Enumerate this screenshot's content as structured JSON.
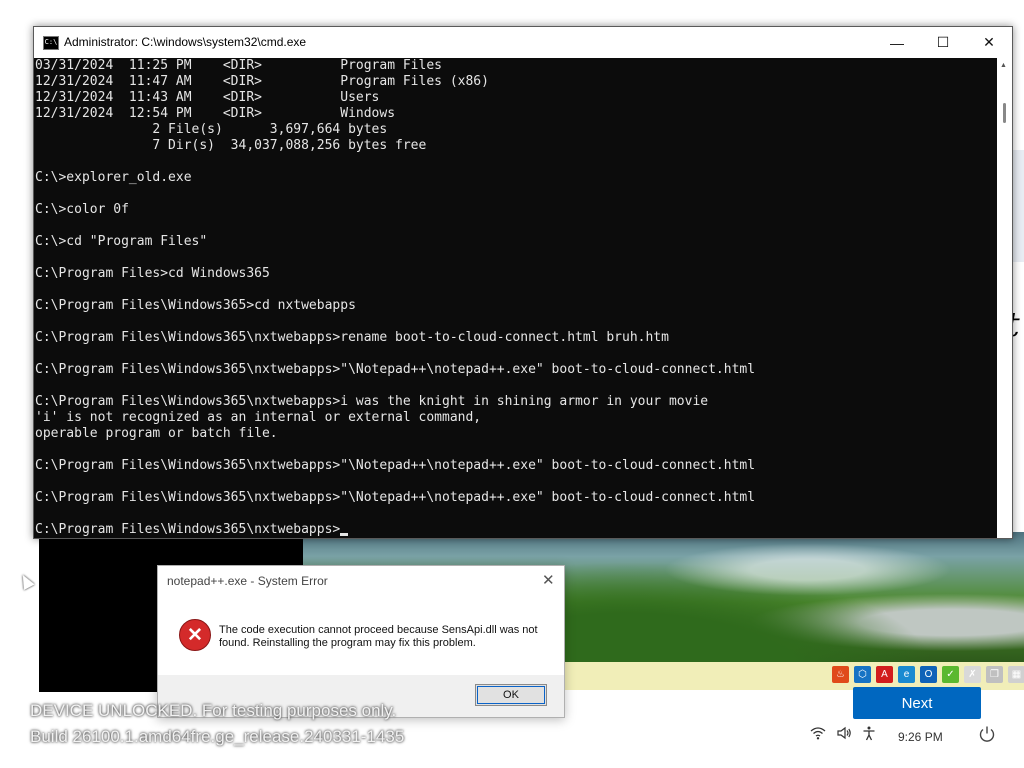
{
  "cmd": {
    "title": "Administrator: C:\\windows\\system32\\cmd.exe",
    "icon_text": "C:\\",
    "lines": [
      "03/31/2024  11:25 PM    <DIR>          Program Files",
      "12/31/2024  11:47 AM    <DIR>          Program Files (x86)",
      "12/31/2024  11:43 AM    <DIR>          Users",
      "12/31/2024  12:54 PM    <DIR>          Windows",
      "               2 File(s)      3,697,664 bytes",
      "               7 Dir(s)  34,037,088,256 bytes free",
      "",
      "C:\\>explorer_old.exe",
      "",
      "C:\\>color 0f",
      "",
      "C:\\>cd \"Program Files\"",
      "",
      "C:\\Program Files>cd Windows365",
      "",
      "C:\\Program Files\\Windows365>cd nxtwebapps",
      "",
      "C:\\Program Files\\Windows365\\nxtwebapps>rename boot-to-cloud-connect.html bruh.htm",
      "",
      "C:\\Program Files\\Windows365\\nxtwebapps>\"\\Notepad++\\notepad++.exe\" boot-to-cloud-connect.html",
      "",
      "C:\\Program Files\\Windows365\\nxtwebapps>i was the knight in shining armor in your movie",
      "'i' is not recognized as an internal or external command,",
      "operable program or batch file.",
      "",
      "C:\\Program Files\\Windows365\\nxtwebapps>\"\\Notepad++\\notepad++.exe\" boot-to-cloud-connect.html",
      "",
      "C:\\Program Files\\Windows365\\nxtwebapps>\"\\Notepad++\\notepad++.exe\" boot-to-cloud-connect.html",
      ""
    ],
    "prompt": "C:\\Program Files\\Windows365\\nxtwebapps>",
    "buttons": {
      "minimize": "—",
      "maximize": "☐",
      "close": "✕"
    }
  },
  "dialog": {
    "title": "notepad++.exe - System Error",
    "message": "The code execution cannot proceed because SensApi.dll was not found. Reinstalling the program may fix this problem.",
    "ok_label": "OK",
    "close_glyph": "✕",
    "error_glyph": "✕"
  },
  "oobe": {
    "next_label": "Next",
    "side_letter": "t"
  },
  "watermark": {
    "line1": "DEVICE UNLOCKED. For testing purposes only.",
    "line2": "Build 26100.1.amd64fre.ge_release.240331-1435"
  },
  "status_bar": {
    "time": "9:26 PM",
    "icons": [
      "wifi-icon",
      "volume-icon",
      "accessibility-icon"
    ],
    "power_icon": "power-icon"
  },
  "tray": {
    "icons": [
      {
        "name": "app-orange-icon",
        "color": "#e04a1a",
        "glyph": "♨"
      },
      {
        "name": "edge-icon",
        "color": "#1673c4",
        "glyph": "⬡"
      },
      {
        "name": "acrobat-icon",
        "color": "#d21d1d",
        "glyph": "A"
      },
      {
        "name": "ie-icon",
        "color": "#1a8ad1",
        "glyph": "e"
      },
      {
        "name": "outlook-icon",
        "color": "#0f62b8",
        "glyph": "O"
      },
      {
        "name": "checkmark-icon",
        "color": "#5bb82f",
        "glyph": "✓"
      },
      {
        "name": "x-window-icon",
        "color": "#d9d9d9",
        "glyph": "✗"
      },
      {
        "name": "copy-icon",
        "color": "#c0c0c0",
        "glyph": "❐"
      },
      {
        "name": "grid-icon",
        "color": "#d0d0d0",
        "glyph": "▦"
      }
    ]
  },
  "colors": {
    "accent": "#0067c0",
    "terminal_bg": "#0c0c0c",
    "error": "#d42a2a"
  }
}
